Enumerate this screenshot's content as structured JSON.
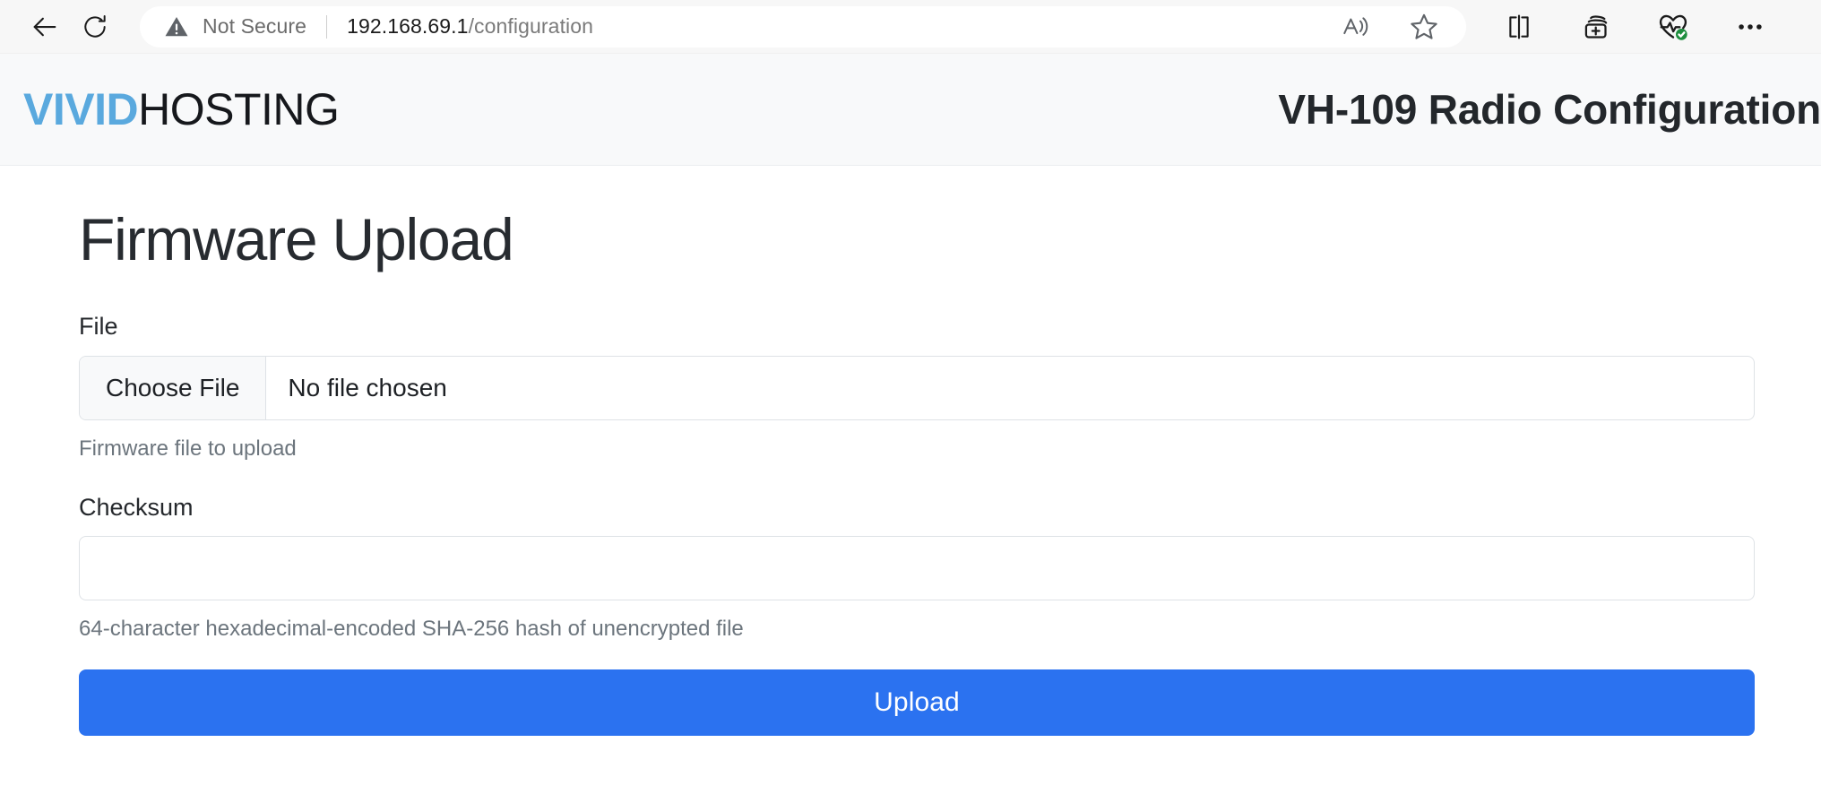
{
  "browser": {
    "back_label": "Back",
    "reload_label": "Reload",
    "security_status": "Not Secure",
    "url_host": "192.168.69.1",
    "url_path": "/configuration",
    "toolbar_icons": [
      "read-aloud-icon",
      "favorite-star-icon",
      "split-screen-icon",
      "add-to-collections-icon",
      "browser-essentials-icon",
      "settings-and-more-icon"
    ]
  },
  "header": {
    "brand_primary": "VIVID",
    "brand_secondary": "HOSTING",
    "title": "VH-109 Radio Configuration"
  },
  "main": {
    "heading": "Firmware Upload",
    "file_field": {
      "label": "File",
      "choose_button": "Choose File",
      "status": "No file chosen",
      "help": "Firmware file to upload"
    },
    "checksum_field": {
      "label": "Checksum",
      "value": "",
      "placeholder": "",
      "help": "64-character hexadecimal-encoded SHA-256 hash of unencrypted file"
    },
    "submit_label": "Upload"
  },
  "colors": {
    "brand_blue": "#5aa9de",
    "accent_blue": "#2b72f0",
    "header_bg": "#f8f9fa",
    "border": "#dee2e6",
    "muted_text": "#6c757d"
  }
}
